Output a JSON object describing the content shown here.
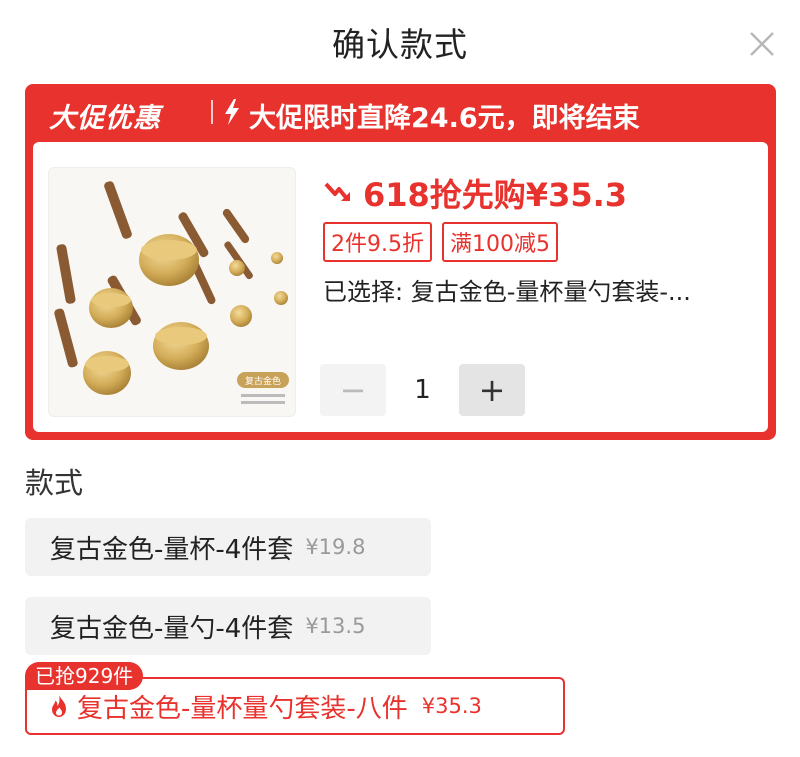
{
  "header": {
    "title": "确认款式",
    "close_icon": "close-icon"
  },
  "promo": {
    "tag": "大促优惠",
    "countdown_text": "大促限时直降24.6元，即将结束",
    "accent_color": "#e8322d"
  },
  "product": {
    "image_label": "复古金色",
    "price_text": "618抢先购¥35.3",
    "coupons": [
      "2件9.5折",
      "满100减5"
    ],
    "selected_text": "已选择: 复古金色-量杯量勺套装-..."
  },
  "stepper": {
    "minus": "−",
    "quantity": "1",
    "plus": "+"
  },
  "styles": {
    "label": "款式",
    "options": [
      {
        "name": "复古金色-量杯-4件套",
        "price": "¥19.8"
      },
      {
        "name": "复古金色-量勺-4件套",
        "price": "¥13.5"
      },
      {
        "name": "复古金色-量杯量勺套装-八件",
        "price": "¥35.3",
        "badge": "已抢929件"
      }
    ]
  }
}
